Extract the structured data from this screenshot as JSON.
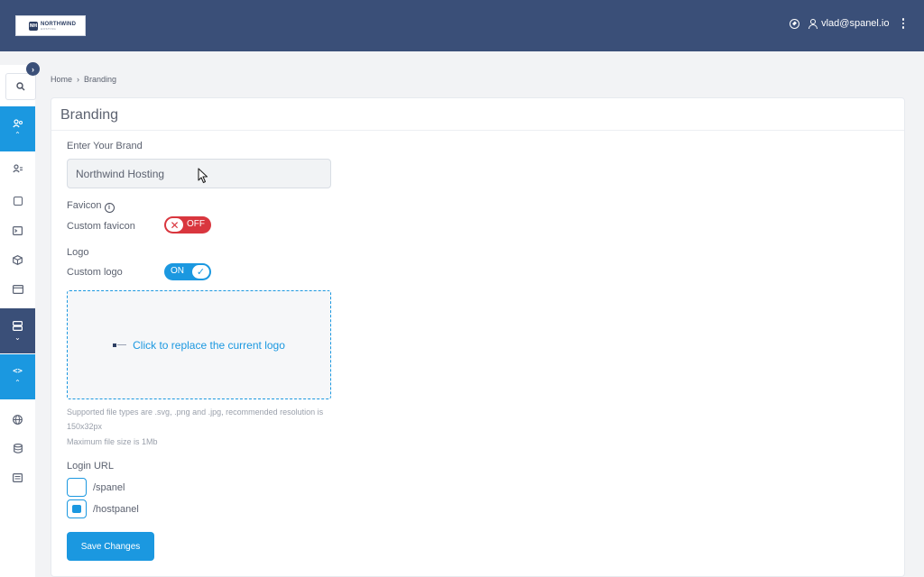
{
  "header": {
    "logo": {
      "mark": "NH",
      "name": "NORTHWIND",
      "sub": "HOSTING"
    },
    "compass_icon": "compass-icon",
    "username": "vlad@spanel.io",
    "menu_icon": "kebab-menu-icon"
  },
  "sidebar": {
    "collapse_icon": "chevron-right-icon",
    "search_icon": "search-icon",
    "items": [
      {
        "icon": "users-group-icon",
        "state": "expanded-blue"
      },
      {
        "icon": "user-accounts-icon",
        "state": "normal"
      },
      {
        "icon": "calendar-icon",
        "state": "normal"
      },
      {
        "icon": "terminal-icon",
        "state": "normal"
      },
      {
        "icon": "package-icon",
        "state": "normal"
      },
      {
        "icon": "browser-window-icon",
        "state": "normal"
      },
      {
        "icon": "server-icon",
        "state": "collapsed-dark"
      },
      {
        "icon": "code-icon",
        "state": "expanded-blue"
      },
      {
        "icon": "globe-icon",
        "state": "normal"
      },
      {
        "icon": "database-icon",
        "state": "normal"
      },
      {
        "icon": "document-icon",
        "state": "normal"
      }
    ]
  },
  "breadcrumb": {
    "home": "Home",
    "separator": "›",
    "current": "Branding"
  },
  "page": {
    "title": "Branding",
    "brand_label": "Enter Your Brand",
    "brand_value": "Northwind Hosting",
    "favicon_label": "Favicon",
    "favicon_info": "i",
    "custom_favicon_label": "Custom favicon",
    "custom_favicon_toggle": {
      "state": "OFF",
      "icon": "x"
    },
    "logo_label": "Logo",
    "custom_logo_label": "Custom logo",
    "custom_logo_toggle": {
      "state": "ON",
      "icon": "✓"
    },
    "dropzone_text": "Click to replace the current logo",
    "hint_line1": "Supported file types are .svg, .png and .jpg, recommended resolution is 150x32px",
    "hint_line2": "Maximum file size is 1Mb",
    "login_url_label": "Login URL",
    "login_options": [
      {
        "label": "/spanel",
        "checked": false
      },
      {
        "label": "/hostpanel",
        "checked": true
      }
    ],
    "save_button": "Save Changes"
  },
  "colors": {
    "header_bg": "#3a4f78",
    "accent": "#1b98e0",
    "danger": "#d9363e"
  }
}
